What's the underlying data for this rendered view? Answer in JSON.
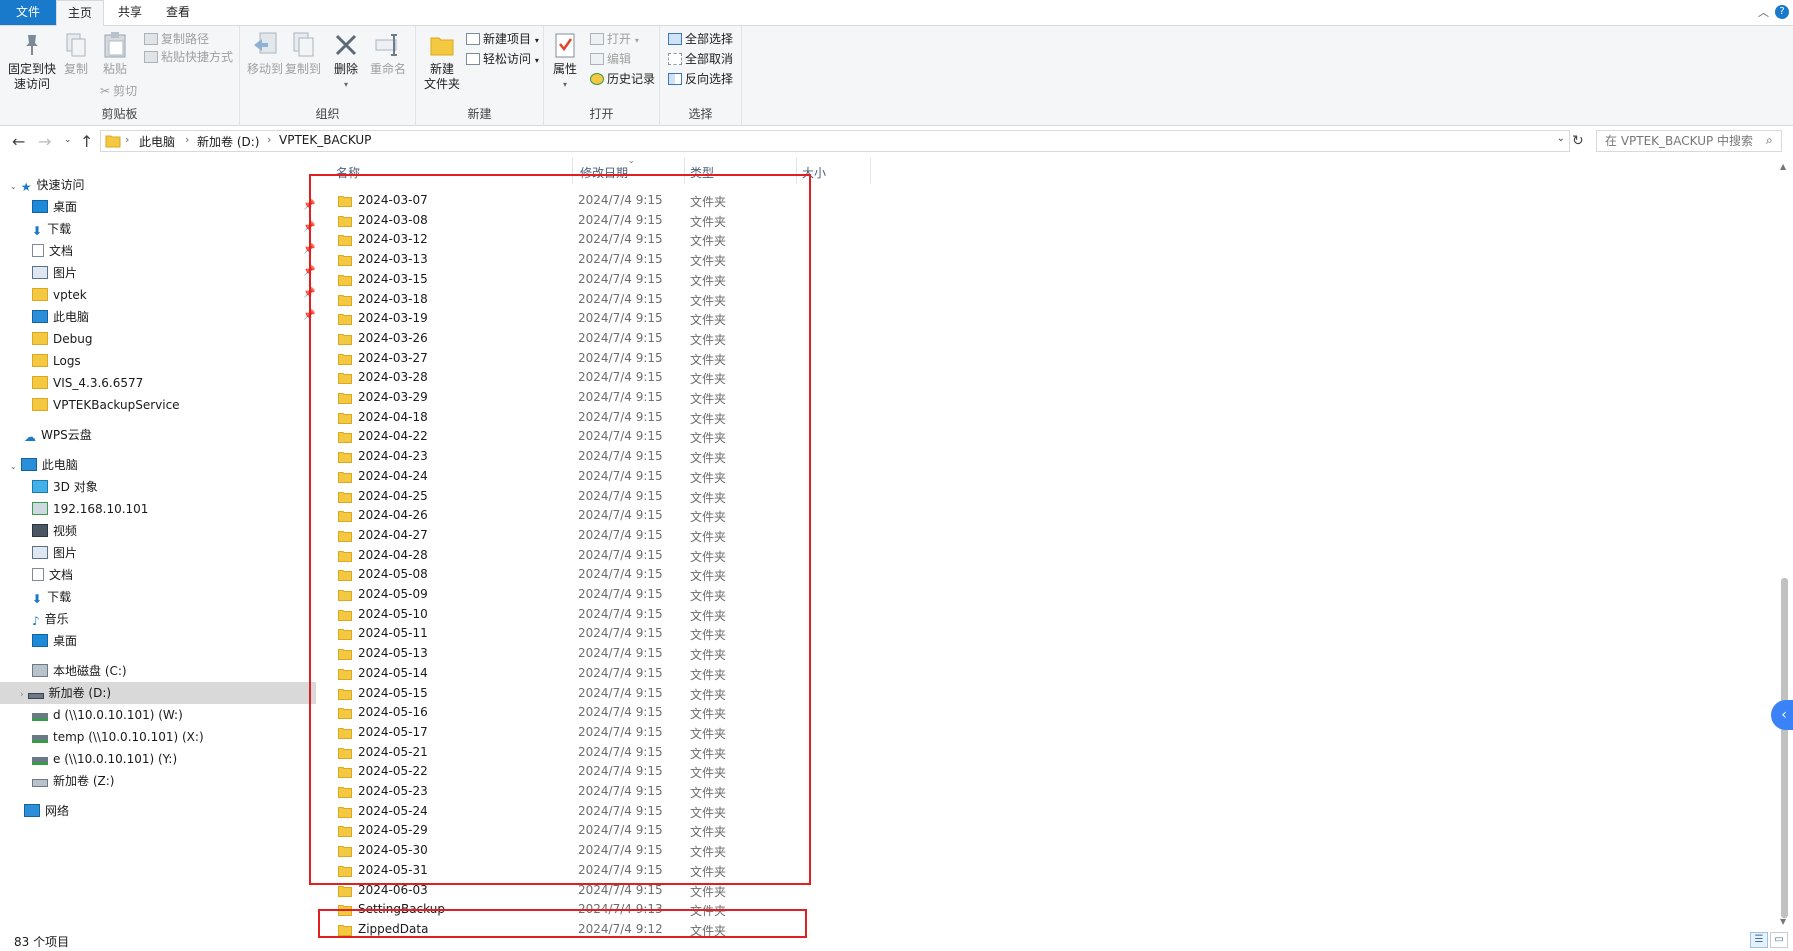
{
  "ribbon_tabs": {
    "file": "文件",
    "home": "主页",
    "share": "共享",
    "view": "查看",
    "help": "?"
  },
  "ribbon": {
    "clipboard": {
      "label": "剪贴板",
      "pin": "固定到快\n速访问",
      "copy": "复制",
      "paste": "粘贴",
      "copy_path": "复制路径",
      "paste_shortcut": "粘贴快捷方式",
      "cut": "剪切"
    },
    "organize": {
      "label": "组织",
      "move_to": "移动到",
      "copy_to": "复制到",
      "delete": "删除",
      "rename": "重命名"
    },
    "new": {
      "label": "新建",
      "new_item": "新建项目",
      "easy_access": "轻松访问",
      "new_folder": "新建\n文件夹"
    },
    "open": {
      "label": "打开",
      "properties": "属性",
      "open": "打开",
      "edit": "编辑",
      "history": "历史记录"
    },
    "select": {
      "label": "选择",
      "select_all": "全部选择",
      "select_none": "全部取消",
      "invert": "反向选择"
    }
  },
  "address": {
    "crumbs": [
      "此电脑",
      "新加卷 (D:)",
      "VPTEK_BACKUP"
    ],
    "search_placeholder": "在 VPTEK_BACKUP 中搜索"
  },
  "nav": {
    "quick_access": "快速访问",
    "quick_items": [
      "桌面",
      "下载",
      "文档",
      "图片",
      "vptek",
      "此电脑",
      "Debug",
      "Logs",
      "VIS_4.3.6.6577",
      "VPTEKBackupService"
    ],
    "wps": "WPS云盘",
    "this_pc": "此电脑",
    "pc_items": [
      "3D 对象",
      "192.168.10.101",
      "视频",
      "图片",
      "文档",
      "下载",
      "音乐",
      "桌面",
      "本地磁盘 (C:)",
      "新加卷 (D:)",
      "d (\\\\10.0.10.101) (W:)",
      "temp (\\\\10.0.10.101) (X:)",
      "e (\\\\10.0.10.101) (Y:)",
      "新加卷 (Z:)"
    ],
    "network": "网络"
  },
  "columns": {
    "name": "名称",
    "date": "修改日期",
    "type": "类型",
    "size": "大小"
  },
  "files": [
    {
      "name": "2024-03-07",
      "date": "2024/7/4 9:15",
      "type": "文件夹"
    },
    {
      "name": "2024-03-08",
      "date": "2024/7/4 9:15",
      "type": "文件夹"
    },
    {
      "name": "2024-03-12",
      "date": "2024/7/4 9:15",
      "type": "文件夹"
    },
    {
      "name": "2024-03-13",
      "date": "2024/7/4 9:15",
      "type": "文件夹"
    },
    {
      "name": "2024-03-15",
      "date": "2024/7/4 9:15",
      "type": "文件夹"
    },
    {
      "name": "2024-03-18",
      "date": "2024/7/4 9:15",
      "type": "文件夹"
    },
    {
      "name": "2024-03-19",
      "date": "2024/7/4 9:15",
      "type": "文件夹"
    },
    {
      "name": "2024-03-26",
      "date": "2024/7/4 9:15",
      "type": "文件夹"
    },
    {
      "name": "2024-03-27",
      "date": "2024/7/4 9:15",
      "type": "文件夹"
    },
    {
      "name": "2024-03-28",
      "date": "2024/7/4 9:15",
      "type": "文件夹"
    },
    {
      "name": "2024-03-29",
      "date": "2024/7/4 9:15",
      "type": "文件夹"
    },
    {
      "name": "2024-04-18",
      "date": "2024/7/4 9:15",
      "type": "文件夹"
    },
    {
      "name": "2024-04-22",
      "date": "2024/7/4 9:15",
      "type": "文件夹"
    },
    {
      "name": "2024-04-23",
      "date": "2024/7/4 9:15",
      "type": "文件夹"
    },
    {
      "name": "2024-04-24",
      "date": "2024/7/4 9:15",
      "type": "文件夹"
    },
    {
      "name": "2024-04-25",
      "date": "2024/7/4 9:15",
      "type": "文件夹"
    },
    {
      "name": "2024-04-26",
      "date": "2024/7/4 9:15",
      "type": "文件夹"
    },
    {
      "name": "2024-04-27",
      "date": "2024/7/4 9:15",
      "type": "文件夹"
    },
    {
      "name": "2024-04-28",
      "date": "2024/7/4 9:15",
      "type": "文件夹"
    },
    {
      "name": "2024-05-08",
      "date": "2024/7/4 9:15",
      "type": "文件夹"
    },
    {
      "name": "2024-05-09",
      "date": "2024/7/4 9:15",
      "type": "文件夹"
    },
    {
      "name": "2024-05-10",
      "date": "2024/7/4 9:15",
      "type": "文件夹"
    },
    {
      "name": "2024-05-11",
      "date": "2024/7/4 9:15",
      "type": "文件夹"
    },
    {
      "name": "2024-05-13",
      "date": "2024/7/4 9:15",
      "type": "文件夹"
    },
    {
      "name": "2024-05-14",
      "date": "2024/7/4 9:15",
      "type": "文件夹"
    },
    {
      "name": "2024-05-15",
      "date": "2024/7/4 9:15",
      "type": "文件夹"
    },
    {
      "name": "2024-05-16",
      "date": "2024/7/4 9:15",
      "type": "文件夹"
    },
    {
      "name": "2024-05-17",
      "date": "2024/7/4 9:15",
      "type": "文件夹"
    },
    {
      "name": "2024-05-21",
      "date": "2024/7/4 9:15",
      "type": "文件夹"
    },
    {
      "name": "2024-05-22",
      "date": "2024/7/4 9:15",
      "type": "文件夹"
    },
    {
      "name": "2024-05-23",
      "date": "2024/7/4 9:15",
      "type": "文件夹"
    },
    {
      "name": "2024-05-24",
      "date": "2024/7/4 9:15",
      "type": "文件夹"
    },
    {
      "name": "2024-05-29",
      "date": "2024/7/4 9:15",
      "type": "文件夹"
    },
    {
      "name": "2024-05-30",
      "date": "2024/7/4 9:15",
      "type": "文件夹"
    },
    {
      "name": "2024-05-31",
      "date": "2024/7/4 9:15",
      "type": "文件夹"
    },
    {
      "name": "2024-06-03",
      "date": "2024/7/4 9:15",
      "type": "文件夹"
    },
    {
      "name": "SettingBackup",
      "date": "2024/7/4 9:13",
      "type": "文件夹"
    },
    {
      "name": "ZippedData",
      "date": "2024/7/4 9:12",
      "type": "文件夹"
    }
  ],
  "status": {
    "count": "83 个项目"
  },
  "colors": {
    "accent": "#1979ca",
    "folder": "#f5c842",
    "annotation": "#e02020",
    "selected": "#d9d9d9"
  }
}
